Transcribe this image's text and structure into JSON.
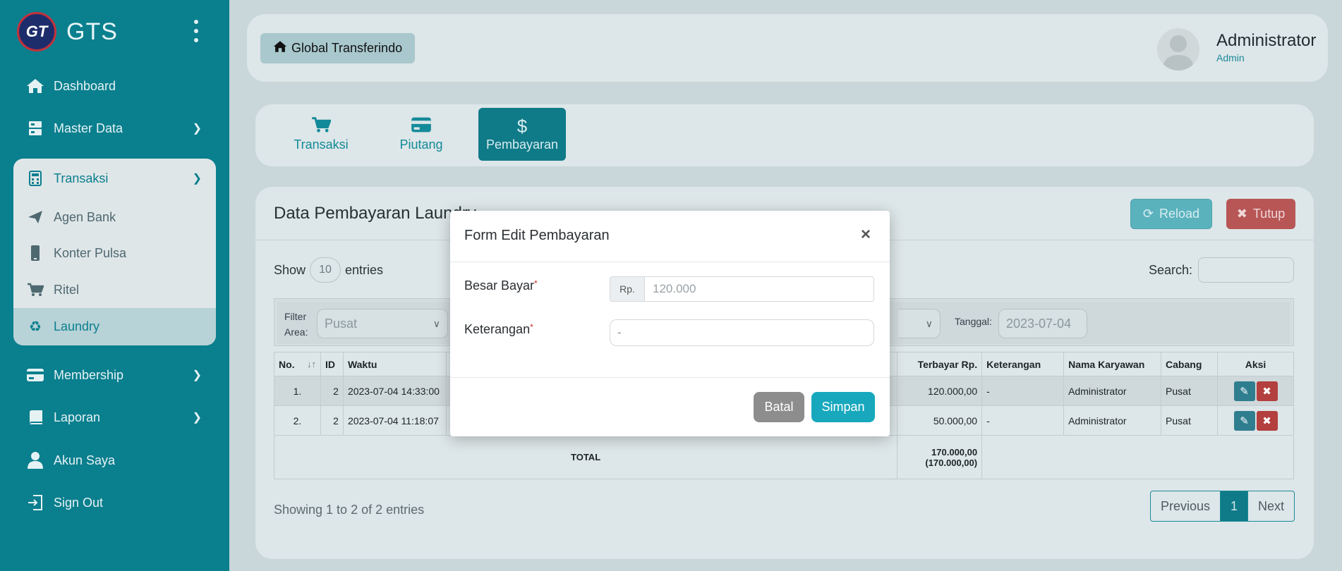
{
  "sidebar": {
    "brand": "GTS",
    "logo_text": "GT",
    "items": [
      {
        "label": "Dashboard",
        "icon": "home-icon"
      },
      {
        "label": "Master Data",
        "icon": "server-icon"
      },
      {
        "label": "Transaksi",
        "icon": "calculator-icon"
      },
      {
        "label": "Agen Bank",
        "icon": "paper-plane-icon"
      },
      {
        "label": "Konter Pulsa",
        "icon": "mobile-icon"
      },
      {
        "label": "Ritel",
        "icon": "cart-icon"
      },
      {
        "label": "Laundry",
        "icon": "recycle-icon"
      },
      {
        "label": "Membership",
        "icon": "credit-card-icon"
      },
      {
        "label": "Laporan",
        "icon": "book-icon"
      },
      {
        "label": "Akun Saya",
        "icon": "user-icon"
      },
      {
        "label": "Sign Out",
        "icon": "sign-out-icon"
      }
    ]
  },
  "header": {
    "company": "Global Transferindo",
    "user_name": "Administrator",
    "user_role": "Admin"
  },
  "tabs": [
    {
      "label": "Transaksi",
      "icon": "cart-icon"
    },
    {
      "label": "Piutang",
      "icon": "credit-card-icon"
    },
    {
      "label": "Pembayaran",
      "icon": "dollar-icon"
    }
  ],
  "card": {
    "title": "Data Pembayaran Laundry",
    "reload_label": "Reload",
    "tutup_label": "Tutup",
    "show_label": "Show",
    "entries_label": "entries",
    "page_length": "10",
    "search_label": "Search:",
    "filter_label_1": "Filter",
    "filter_label_2": "Area:",
    "filter_area": "Pusat",
    "tanggal_label": "Tanggal:",
    "tanggal_value": "2023-07-04",
    "info": "Showing 1 to 2 of 2 entries",
    "pager": {
      "prev": "Previous",
      "current": "1",
      "next": "Next"
    }
  },
  "table": {
    "columns": [
      "No.",
      "ID",
      "Waktu",
      "Terbayar Rp.",
      "Keterangan",
      "Nama Karyawan",
      "Cabang",
      "Aksi"
    ],
    "rows": [
      {
        "no": "1.",
        "id": "2",
        "waktu": "2023-07-04 14:33:00",
        "terbayar": "120.000,00",
        "keterangan": "-",
        "karyawan": "Administrator",
        "cabang": "Pusat"
      },
      {
        "no": "2.",
        "id": "2",
        "waktu": "2023-07-04 11:18:07",
        "terbayar": "50.000,00",
        "keterangan": "-",
        "karyawan": "Administrator",
        "cabang": "Pusat"
      }
    ],
    "total_label": "TOTAL",
    "total_value": "170.000,00",
    "total_sub": "(170.000,00)"
  },
  "modal": {
    "title": "Form Edit Pembayaran",
    "besar_bayar_label": "Besar Bayar",
    "currency_addon": "Rp.",
    "besar_bayar_value": "120.000",
    "keterangan_label": "Keterangan",
    "keterangan_value": "-",
    "required_mark": "*",
    "close_glyph": "×",
    "batal_label": "Batal",
    "simpan_label": "Simpan"
  },
  "colors": {
    "sidebar": "#0a7f8e",
    "accent": "#17a8bd",
    "danger": "#b33f3f",
    "secondary": "#8d8d8d"
  }
}
